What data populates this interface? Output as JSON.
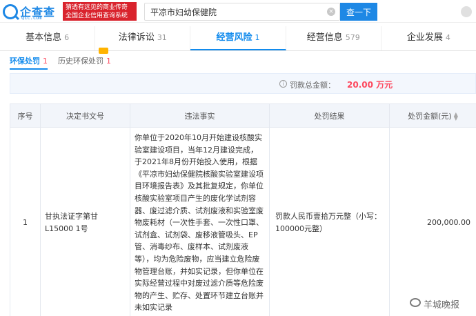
{
  "header": {
    "logo_text": "企查查",
    "logo_sub": "Qcc.com",
    "slogan": "猜透有远见的商业传奇 全国企业信用查询系统",
    "search_value": "平凉市妇幼保健院",
    "search_button": "查一下",
    "accent_color": "#128bed"
  },
  "tabs": [
    {
      "label": "基本信息",
      "count": "6"
    },
    {
      "label": "法律诉讼",
      "count": "31"
    },
    {
      "label": "经营风险",
      "count": "1"
    },
    {
      "label": "经营信息",
      "count": "579"
    },
    {
      "label": "企业发展",
      "count": "4"
    }
  ],
  "subtabs": [
    {
      "label": "环保处罚",
      "count": "1"
    },
    {
      "label": "历史环保处罚",
      "count": "1"
    }
  ],
  "summary": {
    "label": "罚款总金额：",
    "amount": "20.00 万元"
  },
  "table": {
    "headers": [
      "序号",
      "决定书文号",
      "违法事实",
      "处罚结果",
      "处罚金额(元)"
    ],
    "rows": [
      {
        "index": "1",
        "doc_no": "甘执法证字第甘L15000 1号",
        "fact": "你单位于2020年10月开始建设核酸实验室建设项目，当年12月建设完成，于2021年8月份开始投入使用，根据《平凉市妇幼保健院核酸实验室建设项目环境报告表》及其批复规定，你单位核酸实验室项目产生的废化学试剂容器、废过滤介质、试剂废液和实验室废物废耗材（一次性手套、一次性口罩、试剂盒、试剂袋、废移液管吸头、EP管、消毒纱布、废样本、试剂废液等），均为危险废物，应当建立危险废物管理台账，并如实记录，但你单位在实际经营过程中对废过滤介质等危险废物的产生、贮存、处置环节建立台账并未如实记录",
        "result": "罚款人民币壹拾万元整（小写：100000元整）",
        "amount": "200,000.00"
      }
    ]
  },
  "watermark": "羊城晚报"
}
